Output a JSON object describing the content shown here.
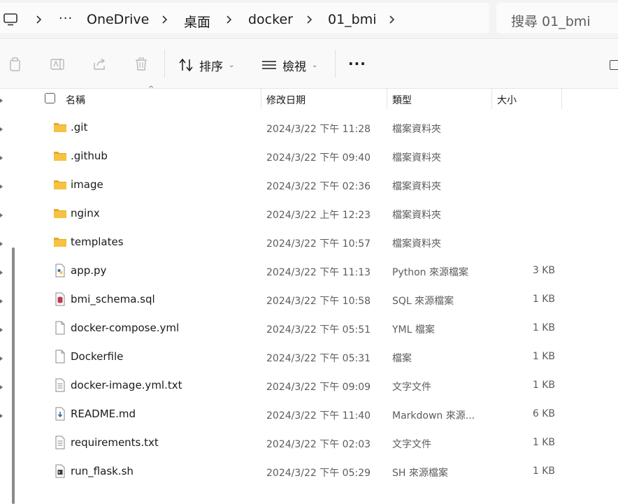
{
  "breadcrumb": {
    "more": "···",
    "items": [
      "OneDrive",
      "桌面",
      "docker",
      "01_bmi"
    ]
  },
  "search": {
    "placeholder": "搜尋 01_bmi"
  },
  "toolbar": {
    "sort_label": "排序",
    "view_label": "檢視",
    "more_label": "···"
  },
  "columns": {
    "name": "名稱",
    "date": "修改日期",
    "type": "類型",
    "size": "大小"
  },
  "files": [
    {
      "name": ".git",
      "date": "2024/3/22 下午 11:28",
      "type": "檔案資料夾",
      "size": "",
      "icon": "folder-icon"
    },
    {
      "name": ".github",
      "date": "2024/3/22 下午 09:40",
      "type": "檔案資料夾",
      "size": "",
      "icon": "folder-icon"
    },
    {
      "name": "image",
      "date": "2024/3/22 下午 02:36",
      "type": "檔案資料夾",
      "size": "",
      "icon": "folder-icon"
    },
    {
      "name": "nginx",
      "date": "2024/3/22 上午 12:23",
      "type": "檔案資料夾",
      "size": "",
      "icon": "folder-icon"
    },
    {
      "name": "templates",
      "date": "2024/3/22 下午 10:57",
      "type": "檔案資料夾",
      "size": "",
      "icon": "folder-icon"
    },
    {
      "name": "app.py",
      "date": "2024/3/22 下午 11:13",
      "type": "Python 來源檔案",
      "size": "3 KB",
      "icon": "python-file-icon"
    },
    {
      "name": "bmi_schema.sql",
      "date": "2024/3/22 下午 10:58",
      "type": "SQL 來源檔案",
      "size": "1 KB",
      "icon": "sql-file-icon"
    },
    {
      "name": "docker-compose.yml",
      "date": "2024/3/22 下午 05:51",
      "type": "YML 檔案",
      "size": "1 KB",
      "icon": "file-icon"
    },
    {
      "name": "Dockerfile",
      "date": "2024/3/22 下午 05:31",
      "type": "檔案",
      "size": "1 KB",
      "icon": "file-icon"
    },
    {
      "name": "docker-image.yml.txt",
      "date": "2024/3/22 下午 09:09",
      "type": "文字文件",
      "size": "1 KB",
      "icon": "text-file-icon"
    },
    {
      "name": "README.md",
      "date": "2024/3/22 下午 11:40",
      "type": "Markdown 來源...",
      "size": "6 KB",
      "icon": "markdown-file-icon"
    },
    {
      "name": "requirements.txt",
      "date": "2024/3/22 下午 02:03",
      "type": "文字文件",
      "size": "1 KB",
      "icon": "text-file-icon"
    },
    {
      "name": "run_flask.sh",
      "date": "2024/3/22 下午 05:29",
      "type": "SH 來源檔案",
      "size": "1 KB",
      "icon": "shell-file-icon"
    }
  ],
  "colors": {
    "folder": "#f5c242",
    "folder_dark": "#e3a92a",
    "python": "#3b78b5",
    "sql": "#c0394a",
    "markdown": "#2e6fb0"
  }
}
